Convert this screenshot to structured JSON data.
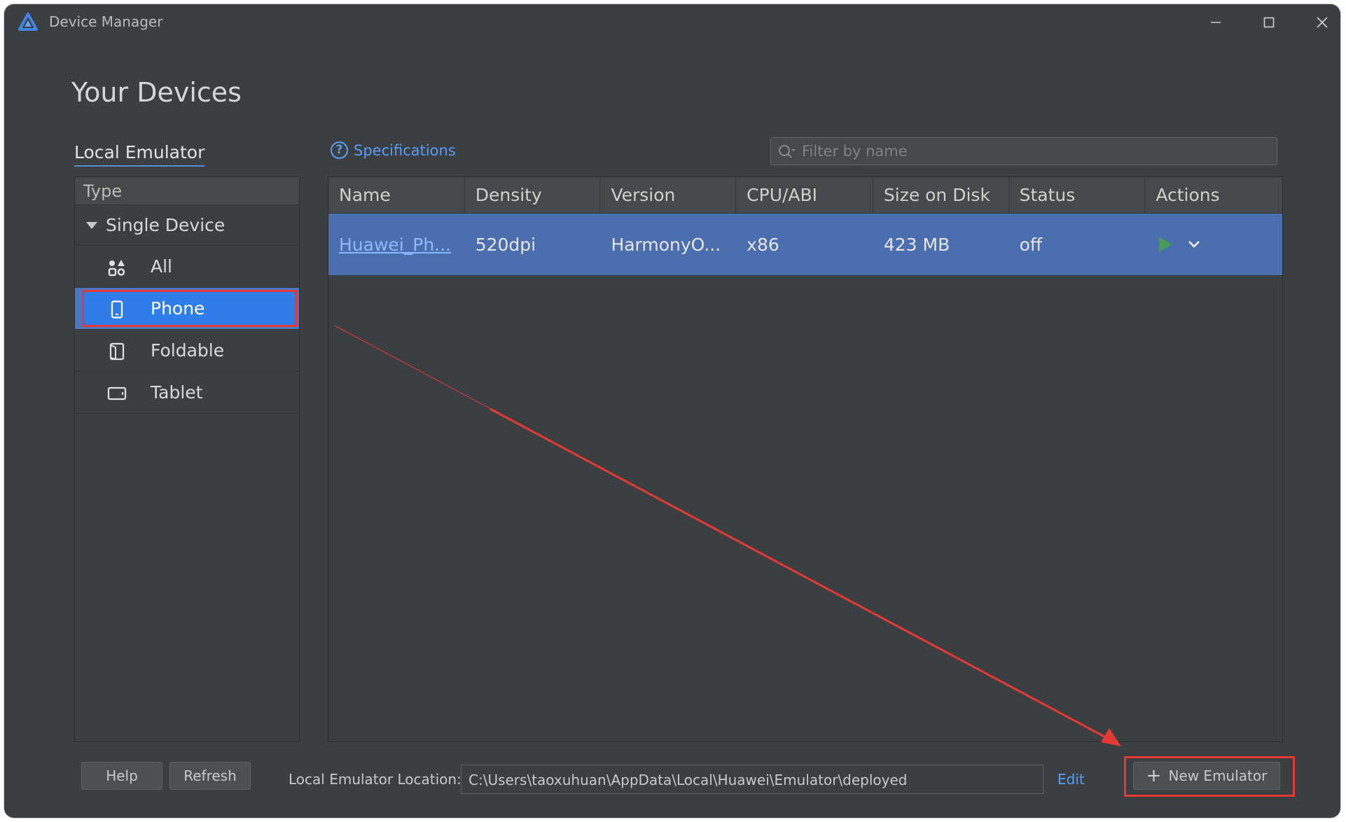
{
  "window": {
    "title": "Device Manager"
  },
  "page": {
    "title": "Your Devices"
  },
  "tabs": {
    "local_emulator": "Local Emulator"
  },
  "specifications": {
    "label": "Specifications"
  },
  "filter": {
    "placeholder": "Filter by name",
    "value": ""
  },
  "type_panel": {
    "header": "Type",
    "group": "Single Device",
    "items": [
      {
        "label": "All",
        "icon": "grid-icon",
        "selected": false
      },
      {
        "label": "Phone",
        "icon": "phone-icon",
        "selected": true
      },
      {
        "label": "Foldable",
        "icon": "foldable-icon",
        "selected": false
      },
      {
        "label": "Tablet",
        "icon": "tablet-icon",
        "selected": false
      }
    ]
  },
  "table": {
    "columns": [
      "Name",
      "Density",
      "Version",
      "CPU/ABI",
      "Size on Disk",
      "Status",
      "Actions"
    ],
    "rows": [
      {
        "name": "Huawei_Ph...",
        "density": "520dpi",
        "version": "HarmonyO...",
        "cpu": "x86",
        "size": "423 MB",
        "status": "off"
      }
    ]
  },
  "bottom": {
    "help": "Help",
    "refresh": "Refresh",
    "location_label": "Local Emulator Location:",
    "location_value": "C:\\Users\\taoxuhuan\\AppData\\Local\\Huawei\\Emulator\\deployed",
    "edit": "Edit",
    "new_emulator": "New Emulator"
  },
  "colors": {
    "background": "#3c3f41",
    "selection": "#4b6eaf",
    "link": "#589df6",
    "annotation": "#e53935",
    "play": "#499c54"
  }
}
